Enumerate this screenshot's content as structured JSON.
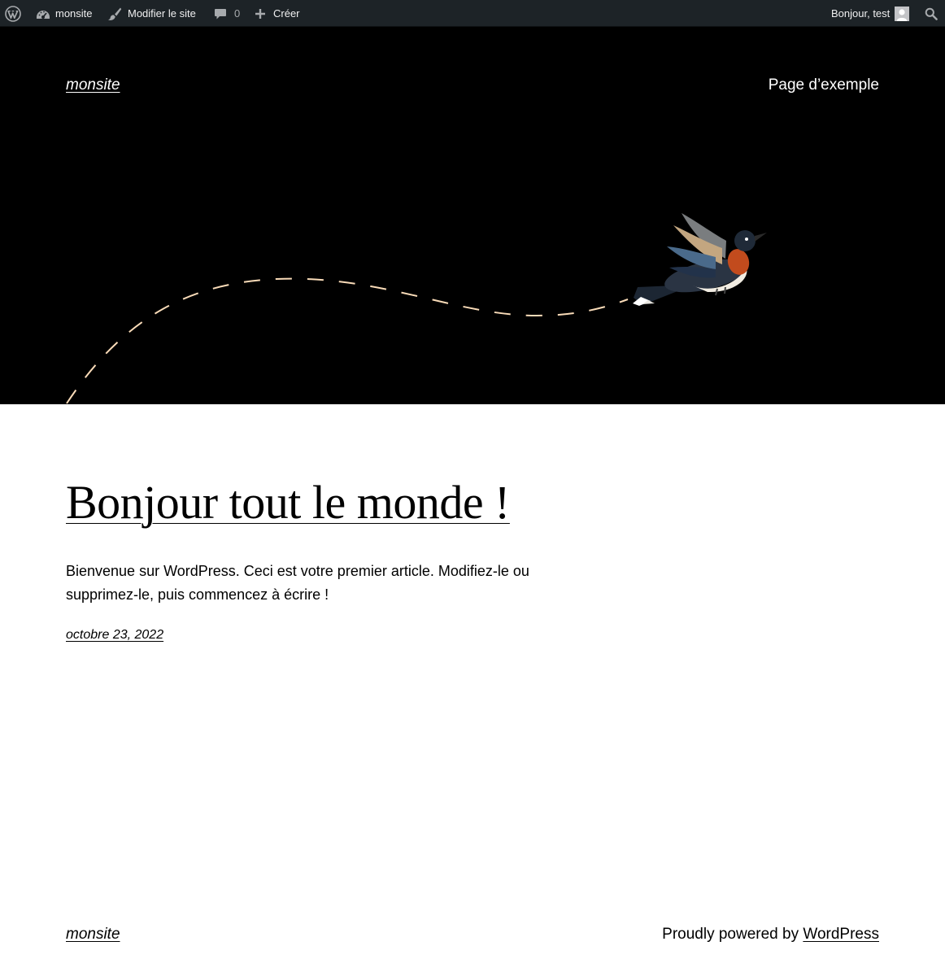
{
  "adminbar": {
    "wp_logo_icon": "wordpress-logo-icon",
    "site_name": "monsite",
    "edit_site_label": "Modifier le site",
    "comments_count": "0",
    "new_label": "Créer",
    "greeting": "Bonjour, test",
    "background_color": "#1d2327"
  },
  "header": {
    "site_title": "monsite",
    "nav_items": [
      "Page d’exemple"
    ],
    "background_color": "#000000",
    "path_color": "#f9dbb8"
  },
  "post": {
    "title": "Bonjour tout le monde !",
    "excerpt": "Bienvenue sur WordPress. Ceci est votre premier article. Modifiez-le ou supprimez-le, puis commencez à écrire !",
    "date": "octobre 23, 2022"
  },
  "footer": {
    "site_title": "monsite",
    "credit_prefix": "Proudly powered by",
    "credit_link": "WordPress"
  }
}
